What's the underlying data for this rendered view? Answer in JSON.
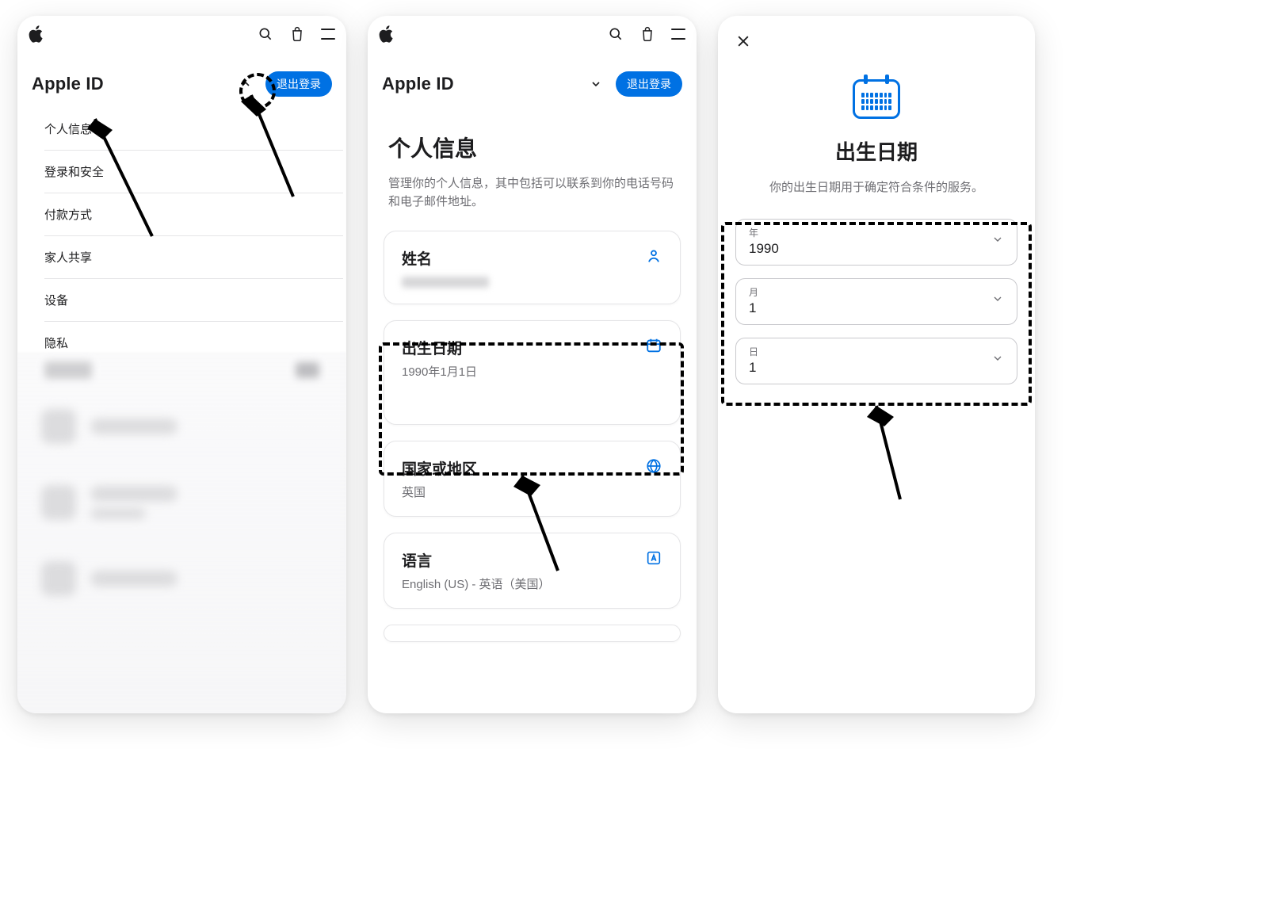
{
  "header": {
    "title": "Apple ID",
    "logout": "退出登录"
  },
  "panelA": {
    "nav": [
      "个人信息",
      "登录和安全",
      "付款方式",
      "家人共享",
      "设备",
      "隐私"
    ]
  },
  "panelB": {
    "title": "个人信息",
    "description": "管理你的个人信息，其中包括可以联系到你的电话号码和电子邮件地址。",
    "cards": {
      "name": {
        "label": "姓名"
      },
      "birthday": {
        "label": "出生日期",
        "value": "1990年1月1日"
      },
      "region": {
        "label": "国家或地区",
        "value": "英国"
      },
      "language": {
        "label": "语言",
        "value": "English (US) - 英语（美国）"
      }
    }
  },
  "panelC": {
    "title": "出生日期",
    "description": "你的出生日期用于确定符合条件的服务。",
    "fields": {
      "year": {
        "label": "年",
        "value": "1990"
      },
      "month": {
        "label": "月",
        "value": "1"
      },
      "day": {
        "label": "日",
        "value": "1"
      }
    }
  }
}
